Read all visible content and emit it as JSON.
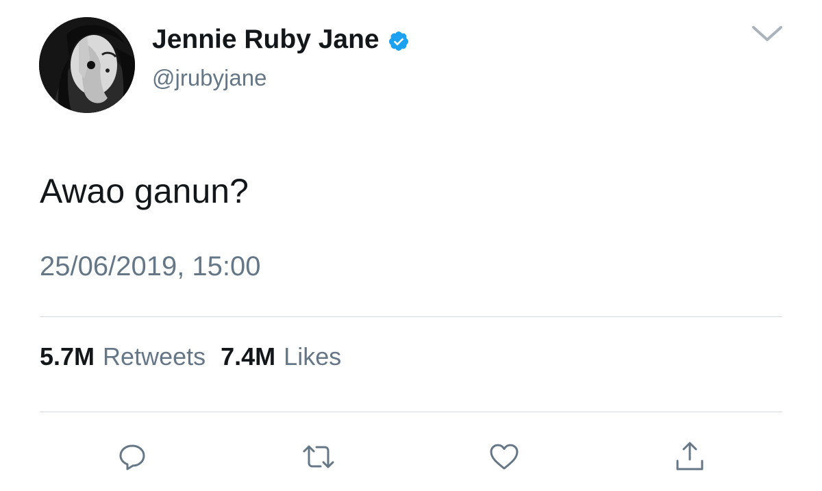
{
  "tweet": {
    "display_name": "Jennie Ruby Jane",
    "handle": "@jrubyjane",
    "verified": true,
    "text": "Awao ganun?",
    "timestamp": "25/06/2019, 15:00"
  },
  "stats": {
    "retweets_count": "5.7M",
    "retweets_label": "Retweets",
    "likes_count": "7.4M",
    "likes_label": "Likes"
  },
  "icons": {
    "verified": "verified-badge-icon",
    "menu": "chevron-down-icon",
    "reply": "reply-icon",
    "retweet": "retweet-icon",
    "like": "heart-icon",
    "share": "share-icon"
  },
  "colors": {
    "verified_blue": "#1da1f2",
    "primary_text": "#14171a",
    "secondary_text": "#657786",
    "icon_gray": "#657786",
    "divider": "#d6dbdf"
  }
}
